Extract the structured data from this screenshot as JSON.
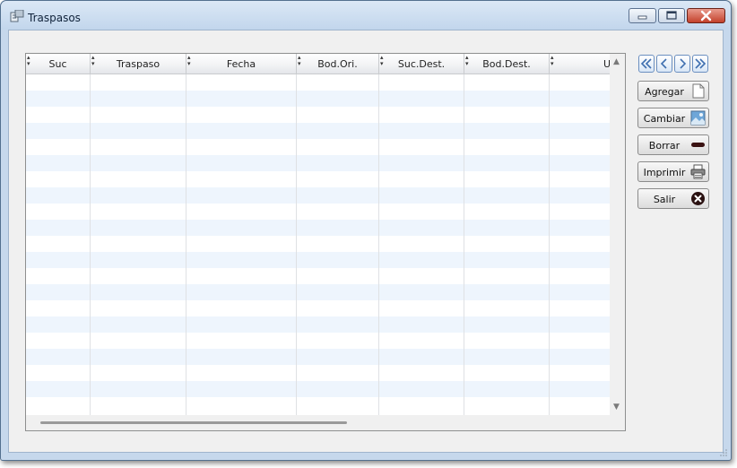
{
  "window": {
    "title": "Traspasos"
  },
  "table": {
    "columns": [
      {
        "label": "Suc"
      },
      {
        "label": "Traspaso"
      },
      {
        "label": "Fecha"
      },
      {
        "label": "Bod.Ori."
      },
      {
        "label": "Suc.Dest."
      },
      {
        "label": "Bod.Dest."
      },
      {
        "label": "U"
      }
    ],
    "rows": []
  },
  "buttons": {
    "agregar": "Agregar",
    "cambiar": "Cambiar",
    "borrar": "Borrar",
    "imprimir": "Imprimir",
    "salir": "Salir"
  },
  "icons": {
    "app": "transfer-icon",
    "first": "first-record-icon",
    "prev": "previous-record-icon",
    "next": "next-record-icon",
    "last": "last-record-icon",
    "agregar": "new-document-icon",
    "cambiar": "edit-image-icon",
    "borrar": "minus-icon",
    "imprimir": "printer-icon",
    "salir": "close-circle-icon"
  },
  "colors": {
    "row_alt": "#eef5fd",
    "nav_accent": "#6b8fc0"
  }
}
